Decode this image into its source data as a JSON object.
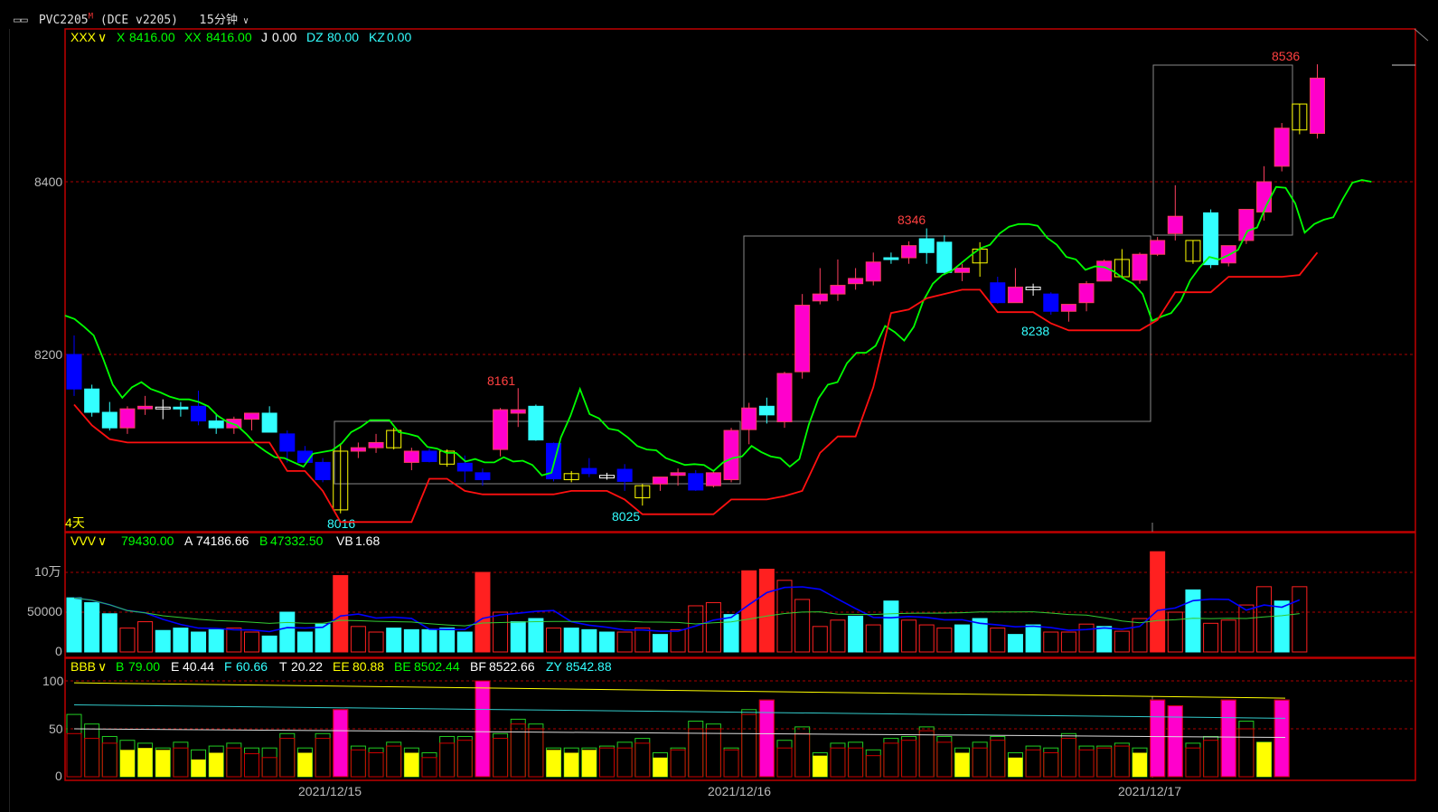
{
  "window": {
    "symbol": "PVC2205",
    "symbol_sup": "M",
    "exchange": "(DCE v2205)",
    "period": "15分钟"
  },
  "main_panel": {
    "indicator": "XXX",
    "x_label": "X",
    "x_value": "8416.00",
    "xx_label": "XX",
    "xx_value": "8416.00",
    "j_label": "J",
    "j_value": "0.00",
    "dz_label": "DZ",
    "dz_value": "80.00",
    "kz_label": "KZ",
    "kz_value": "0.00",
    "ticks": [
      "8400",
      "8200"
    ],
    "bottom_note": "4天",
    "annotations": [
      {
        "text": "8161",
        "color": "#ff4040"
      },
      {
        "text": "8016",
        "color": "#33ffff"
      },
      {
        "text": "8025",
        "color": "#33ffff"
      },
      {
        "text": "8346",
        "color": "#ff4040"
      },
      {
        "text": "8238",
        "color": "#33ffff"
      },
      {
        "text": "8536",
        "color": "#ff4040"
      }
    ]
  },
  "volume_panel": {
    "indicator": "VVV",
    "v1_value": "79430.00",
    "a_label": "A",
    "a_value": "74186.66",
    "b_label": "B",
    "b_value": "47332.50",
    "vb_label": "VB",
    "vb_value": "1.68",
    "ticks": [
      "10万",
      "50000",
      "0"
    ]
  },
  "lower_panel": {
    "indicator": "BBB",
    "b_label": "B",
    "b_value": "79.00",
    "e_label": "E",
    "e_value": "40.44",
    "f_label": "F",
    "f_value": "60.66",
    "t_label": "T",
    "t_value": "20.22",
    "ee_label": "EE",
    "ee_value": "80.88",
    "be_label": "BE",
    "be_value": "8502.44",
    "bf_label": "BF",
    "bf_value": "8522.66",
    "zy_label": "ZY",
    "zy_value": "8542.88",
    "ticks": [
      "100",
      "50",
      "0"
    ]
  },
  "x_axis": {
    "dates": [
      "2021/12/15",
      "2021/12/16",
      "2021/12/17"
    ]
  },
  "colors": {
    "up": "#ff00cc",
    "down": "#33ffff",
    "blue": "#0000ff",
    "red": "#ff2020",
    "green": "#00ff00",
    "yellow": "#ffff00",
    "grid": "#aa0000"
  },
  "chart_data": {
    "type": "candlestick",
    "candles": [
      [
        8200,
        8222,
        8152,
        8160,
        "b"
      ],
      [
        8160,
        8165,
        8128,
        8133,
        "c"
      ],
      [
        8133,
        8145,
        8112,
        8115,
        "c"
      ],
      [
        8115,
        8140,
        8108,
        8137,
        "r"
      ],
      [
        8137,
        8152,
        8130,
        8140,
        "r"
      ],
      [
        8138,
        8148,
        8125,
        8139,
        "x"
      ],
      [
        8139,
        8145,
        8128,
        8137,
        "c"
      ],
      [
        8140,
        8158,
        8118,
        8123,
        "b"
      ],
      [
        8123,
        8131,
        8108,
        8115,
        "c"
      ],
      [
        8115,
        8128,
        8108,
        8125,
        "r"
      ],
      [
        8125,
        8132,
        8112,
        8132,
        "r"
      ],
      [
        8132,
        8140,
        8110,
        8110,
        "c"
      ],
      [
        8108,
        8112,
        8075,
        8088,
        "b"
      ],
      [
        8088,
        8094,
        8075,
        8075,
        "b"
      ],
      [
        8075,
        8080,
        8052,
        8055,
        "b"
      ],
      [
        8020,
        8096,
        8016,
        8088,
        "y"
      ],
      [
        8088,
        8098,
        8080,
        8092,
        "r"
      ],
      [
        8092,
        8108,
        8086,
        8098,
        "r"
      ],
      [
        8112,
        8115,
        8090,
        8092,
        "y"
      ],
      [
        8075,
        8092,
        8066,
        8088,
        "r"
      ],
      [
        8088,
        8091,
        8075,
        8076,
        "b"
      ],
      [
        8088,
        8090,
        8070,
        8073,
        "y"
      ],
      [
        8074,
        8083,
        8052,
        8065,
        "b"
      ],
      [
        8063,
        8068,
        8048,
        8055,
        "b"
      ],
      [
        8090,
        8138,
        8082,
        8136,
        "r"
      ],
      [
        8132,
        8161,
        8116,
        8136,
        "r"
      ],
      [
        8140,
        8142,
        8100,
        8101,
        "c"
      ],
      [
        8097,
        8098,
        8053,
        8056,
        "b"
      ],
      [
        8055,
        8065,
        8052,
        8062,
        "y"
      ],
      [
        8062,
        8080,
        8058,
        8068,
        "b"
      ],
      [
        8057,
        8063,
        8055,
        8060,
        "x"
      ],
      [
        8067,
        8073,
        8042,
        8053,
        "b"
      ],
      [
        8034,
        8050,
        8025,
        8048,
        "y"
      ],
      [
        8050,
        8058,
        8042,
        8058,
        "r"
      ],
      [
        8060,
        8068,
        8048,
        8063,
        "r"
      ],
      [
        8043,
        8066,
        8042,
        8062,
        "b"
      ],
      [
        8063,
        8065,
        8046,
        8048,
        "r"
      ],
      [
        8055,
        8115,
        8052,
        8112,
        "r"
      ],
      [
        8113,
        8144,
        8096,
        8138,
        "r"
      ],
      [
        8140,
        8150,
        8120,
        8130,
        "c"
      ],
      [
        8122,
        8180,
        8115,
        8178,
        "r"
      ],
      [
        8180,
        8270,
        8172,
        8257,
        "r"
      ],
      [
        8262,
        8300,
        8258,
        8270,
        "r"
      ],
      [
        8270,
        8310,
        8262,
        8280,
        "r"
      ],
      [
        8282,
        8300,
        8275,
        8288,
        "r"
      ],
      [
        8285,
        8318,
        8280,
        8307,
        "r"
      ],
      [
        8310,
        8318,
        8305,
        8312,
        "c"
      ],
      [
        8312,
        8331,
        8305,
        8326,
        "r"
      ],
      [
        8334,
        8346,
        8305,
        8318,
        "c"
      ],
      [
        8330,
        8338,
        8292,
        8295,
        "c"
      ],
      [
        8295,
        8305,
        8285,
        8300,
        "r"
      ],
      [
        8322,
        8330,
        8290,
        8306,
        "y"
      ],
      [
        8283,
        8290,
        8259,
        8260,
        "b"
      ],
      [
        8260,
        8300,
        8260,
        8278,
        "r"
      ],
      [
        8275,
        8282,
        8268,
        8278,
        "x"
      ],
      [
        8270,
        8272,
        8246,
        8250,
        "b"
      ],
      [
        8250,
        8258,
        8238,
        8258,
        "r"
      ],
      [
        8260,
        8285,
        8250,
        8282,
        "r"
      ],
      [
        8285,
        8310,
        8285,
        8308,
        "r"
      ],
      [
        8290,
        8322,
        8288,
        8310,
        "y"
      ],
      [
        8286,
        8318,
        8282,
        8316,
        "r"
      ],
      [
        8316,
        8336,
        8314,
        8332,
        "r"
      ],
      [
        8340,
        8396,
        8332,
        8360,
        "r"
      ],
      [
        8308,
        8332,
        8305,
        8332,
        "y"
      ],
      [
        8364,
        8368,
        8300,
        8304,
        "c"
      ],
      [
        8306,
        8326,
        8302,
        8326,
        "r"
      ],
      [
        8332,
        8364,
        8328,
        8368,
        "r"
      ],
      [
        8365,
        8418,
        8355,
        8400,
        "r"
      ],
      [
        8418,
        8468,
        8412,
        8462,
        "r"
      ],
      [
        8460,
        8490,
        8455,
        8490,
        "y"
      ],
      [
        8456,
        8536,
        8450,
        8520,
        "r"
      ]
    ],
    "line_green": [
      8245,
      8241,
      8232,
      8222,
      8195,
      8165,
      8150,
      8162,
      8168,
      8160,
      8156,
      8151,
      8148,
      8148,
      8145,
      8140,
      8129,
      8122,
      8118,
      8108,
      8096,
      8088,
      8081,
      8080,
      8075,
      8070,
      8085,
      8087,
      8089,
      8097,
      8110,
      8116,
      8124,
      8124,
      8124,
      8110,
      8108,
      8105,
      8093,
      8091,
      8086,
      8086,
      8076,
      8079,
      8075,
      8075,
      8081,
      8076,
      8077,
      8072,
      8060,
      8063,
      8104,
      8129,
      8160,
      8131,
      8126,
      8114,
      8112,
      8104,
      8094,
      8090,
      8089,
      8080,
      8076,
      8072,
      8073,
      8072,
      8065,
      8075,
      8080,
      8082,
      8094,
      8087,
      8082,
      8080,
      8070,
      8079,
      8119,
      8149,
      8165,
      8168,
      8190,
      8202,
      8202,
      8210,
      8233,
      8226,
      8216,
      8232,
      8262,
      8282,
      8292,
      8297,
      8306,
      8315,
      8323,
      8327,
      8340,
      8348,
      8351,
      8351,
      8349,
      8335,
      8327,
      8313,
      8310,
      8298,
      8302,
      8301,
      8296,
      8288,
      8282,
      8270,
      8239,
      8244,
      8248,
      8262,
      8286,
      8301,
      8313,
      8310,
      8315,
      8321,
      8343,
      8347,
      8373,
      8394,
      8393,
      8375,
      8341,
      8351,
      8356,
      8359,
      8380,
      8399,
      8402,
      8400
    ],
    "volume": [
      [
        68000,
        "c"
      ],
      [
        62000,
        "c"
      ],
      [
        48000,
        "c"
      ],
      [
        30000,
        "o"
      ],
      [
        38000,
        "o"
      ],
      [
        27000,
        "c"
      ],
      [
        30000,
        "c"
      ],
      [
        25000,
        "c"
      ],
      [
        28000,
        "c"
      ],
      [
        30000,
        "o"
      ],
      [
        25000,
        "o"
      ],
      [
        20000,
        "c"
      ],
      [
        50000,
        "c"
      ],
      [
        25000,
        "c"
      ],
      [
        35000,
        "c"
      ],
      [
        96000,
        "r"
      ],
      [
        32000,
        "o"
      ],
      [
        25000,
        "o"
      ],
      [
        30000,
        "c"
      ],
      [
        28000,
        "c"
      ],
      [
        28000,
        "c"
      ],
      [
        30000,
        "c"
      ],
      [
        25000,
        "c"
      ],
      [
        100000,
        "r"
      ],
      [
        50000,
        "o"
      ],
      [
        38000,
        "c"
      ],
      [
        42000,
        "c"
      ],
      [
        30000,
        "o"
      ],
      [
        30000,
        "c"
      ],
      [
        28000,
        "c"
      ],
      [
        25000,
        "c"
      ],
      [
        25000,
        "o"
      ],
      [
        30000,
        "o"
      ],
      [
        22000,
        "c"
      ],
      [
        28000,
        "o"
      ],
      [
        58000,
        "o"
      ],
      [
        62000,
        "o"
      ],
      [
        47000,
        "c"
      ],
      [
        102000,
        "r"
      ],
      [
        104000,
        "r"
      ],
      [
        90000,
        "o"
      ],
      [
        66000,
        "o"
      ],
      [
        32000,
        "o"
      ],
      [
        40000,
        "o"
      ],
      [
        45000,
        "c"
      ],
      [
        34000,
        "o"
      ],
      [
        64000,
        "c"
      ],
      [
        40000,
        "o"
      ],
      [
        34000,
        "o"
      ],
      [
        30000,
        "o"
      ],
      [
        34000,
        "c"
      ],
      [
        42000,
        "c"
      ],
      [
        30000,
        "o"
      ],
      [
        22000,
        "c"
      ],
      [
        34000,
        "c"
      ],
      [
        25000,
        "o"
      ],
      [
        25000,
        "o"
      ],
      [
        35000,
        "o"
      ],
      [
        32000,
        "c"
      ],
      [
        26000,
        "o"
      ],
      [
        42000,
        "o"
      ],
      [
        126000,
        "r"
      ],
      [
        50000,
        "o"
      ],
      [
        78000,
        "c"
      ],
      [
        36000,
        "o"
      ],
      [
        40000,
        "o"
      ],
      [
        59000,
        "o"
      ],
      [
        82000,
        "o"
      ],
      [
        64000,
        "c"
      ],
      [
        82000,
        "o"
      ]
    ],
    "lower_bars": [
      [
        65,
        45,
        "g"
      ],
      [
        55,
        40,
        "g"
      ],
      [
        42,
        35,
        "g"
      ],
      [
        38,
        28,
        "y"
      ],
      [
        35,
        30,
        "y"
      ],
      [
        30,
        28,
        "y"
      ],
      [
        36,
        30,
        "g"
      ],
      [
        28,
        18,
        "y"
      ],
      [
        32,
        25,
        "y"
      ],
      [
        35,
        30,
        "g"
      ],
      [
        30,
        24,
        "g"
      ],
      [
        30,
        20,
        "g"
      ],
      [
        45,
        40,
        "g"
      ],
      [
        30,
        25,
        "y"
      ],
      [
        45,
        40,
        "g"
      ],
      [
        70,
        70,
        "m"
      ],
      [
        32,
        28,
        "g"
      ],
      [
        30,
        25,
        "g"
      ],
      [
        36,
        32,
        "g"
      ],
      [
        30,
        25,
        "y"
      ],
      [
        25,
        20,
        "g"
      ],
      [
        42,
        35,
        "g"
      ],
      [
        42,
        38,
        "g"
      ],
      [
        100,
        100,
        "m"
      ],
      [
        45,
        40,
        "g"
      ],
      [
        60,
        55,
        "g"
      ],
      [
        55,
        50,
        "g"
      ],
      [
        30,
        28,
        "y"
      ],
      [
        30,
        25,
        "y"
      ],
      [
        30,
        28,
        "y"
      ],
      [
        32,
        30,
        "g"
      ],
      [
        36,
        30,
        "g"
      ],
      [
        40,
        35,
        "g"
      ],
      [
        25,
        20,
        "y"
      ],
      [
        30,
        28,
        "g"
      ],
      [
        58,
        50,
        "g"
      ],
      [
        55,
        50,
        "g"
      ],
      [
        30,
        28,
        "g"
      ],
      [
        70,
        65,
        "g"
      ],
      [
        80,
        80,
        "m"
      ],
      [
        38,
        30,
        "g"
      ],
      [
        52,
        45,
        "g"
      ],
      [
        25,
        22,
        "y"
      ],
      [
        35,
        30,
        "g"
      ],
      [
        36,
        30,
        "g"
      ],
      [
        28,
        22,
        "g"
      ],
      [
        40,
        35,
        "g"
      ],
      [
        42,
        38,
        "g"
      ],
      [
        52,
        48,
        "g"
      ],
      [
        42,
        36,
        "g"
      ],
      [
        30,
        25,
        "y"
      ],
      [
        36,
        30,
        "g"
      ],
      [
        42,
        38,
        "g"
      ],
      [
        25,
        20,
        "y"
      ],
      [
        32,
        28,
        "g"
      ],
      [
        30,
        25,
        "g"
      ],
      [
        45,
        40,
        "g"
      ],
      [
        32,
        28,
        "g"
      ],
      [
        32,
        30,
        "g"
      ],
      [
        35,
        32,
        "g"
      ],
      [
        30,
        25,
        "y"
      ],
      [
        80,
        80,
        "m"
      ],
      [
        74,
        74,
        "m"
      ],
      [
        35,
        30,
        "g"
      ],
      [
        42,
        38,
        "g"
      ],
      [
        80,
        80,
        "m"
      ],
      [
        58,
        50,
        "g"
      ],
      [
        36,
        36,
        "y"
      ],
      [
        80,
        80,
        "m"
      ]
    ]
  }
}
